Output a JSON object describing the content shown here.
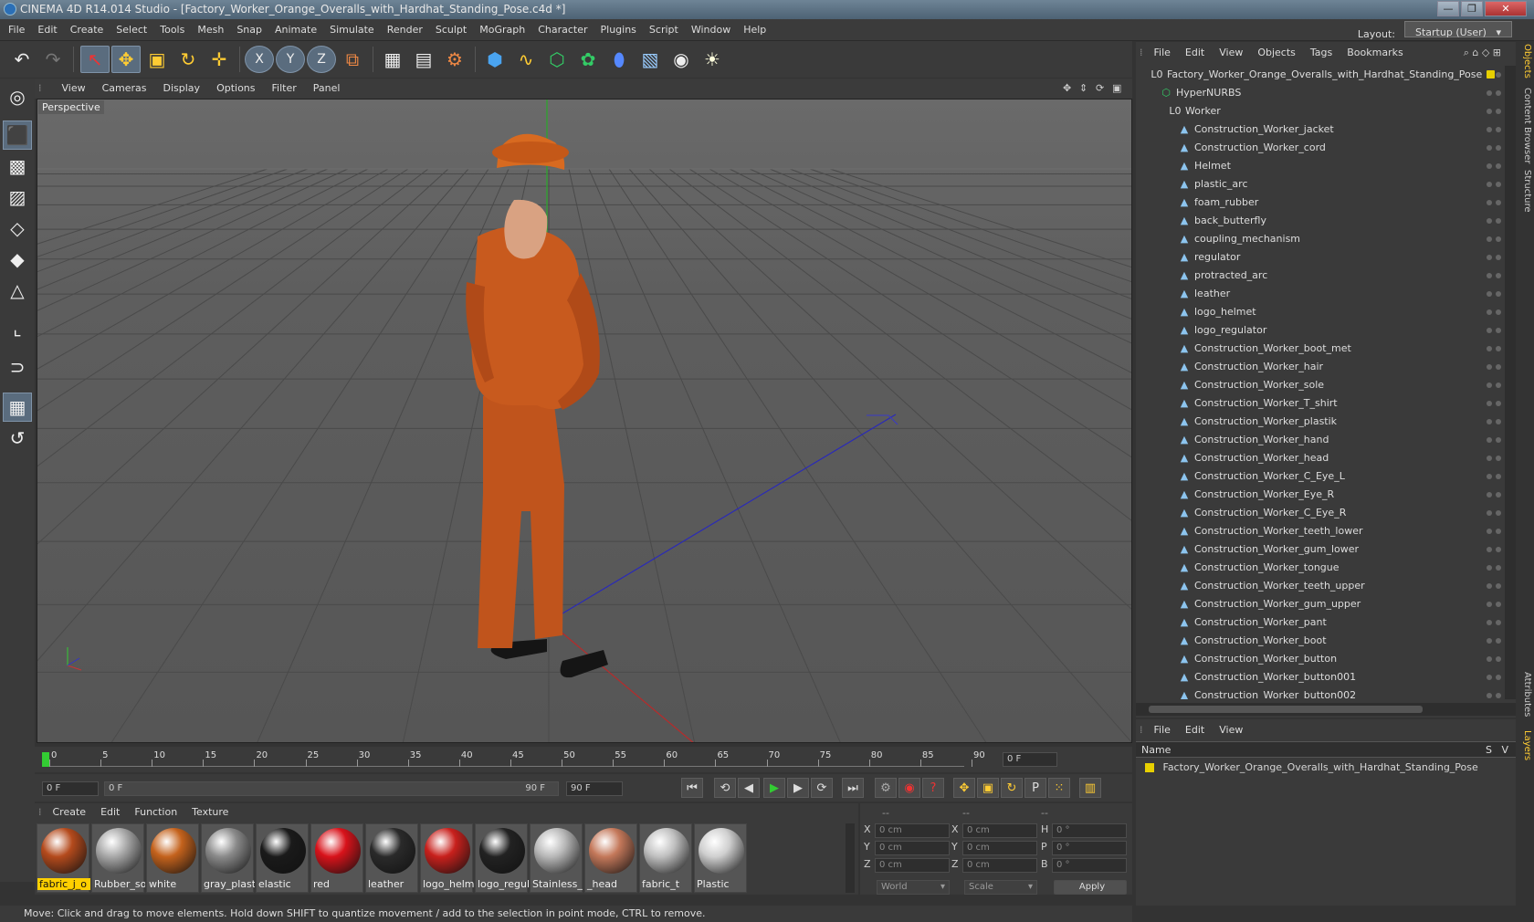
{
  "window": {
    "title": "CINEMA 4D R14.014 Studio - [Factory_Worker_Orange_Overalls_with_Hardhat_Standing_Pose.c4d *]",
    "controls": [
      "—",
      "❐",
      "✕"
    ]
  },
  "menubar": {
    "items": [
      "File",
      "Edit",
      "Create",
      "Select",
      "Tools",
      "Mesh",
      "Snap",
      "Animate",
      "Simulate",
      "Render",
      "Sculpt",
      "MoGraph",
      "Character",
      "Plugins",
      "Script",
      "Window",
      "Help"
    ],
    "layout_label": "Layout:",
    "layout_value": "Startup (User)"
  },
  "toolbar": {
    "icons": [
      "undo-icon",
      "redo-icon",
      "live-select-icon",
      "move-icon",
      "scale-icon",
      "rotate-icon",
      "add-icon",
      "x-axis-icon",
      "y-axis-icon",
      "z-axis-icon",
      "coordinate-system-icon",
      "render-view-icon",
      "render-picture-viewer-icon",
      "render-settings-icon",
      "cube-icon",
      "spline-icon",
      "nurbs-icon",
      "array-icon",
      "deformer-icon",
      "floor-icon",
      "camera-icon",
      "light-icon"
    ],
    "glyphs": {
      "undo": "↶",
      "redo": "↷",
      "live_select": "↖",
      "move": "✥",
      "scale": "▣",
      "rotate": "↻",
      "add": "✛",
      "x": "X",
      "y": "Y",
      "z": "Z",
      "coord": "⧉",
      "render_view": "▦",
      "render_pv": "▤",
      "render_set": "⚙",
      "cube": "⬢",
      "spline": "∿",
      "nurbs": "⬡",
      "array": "✿",
      "deformer": "⬮",
      "floor": "▧",
      "camera": "◉",
      "light": "☀"
    }
  },
  "left_toolbar": {
    "icons": [
      "make-editable-icon",
      "model-mode-icon",
      "texture-mode-icon",
      "workplane-mode-icon",
      "points-mode-icon",
      "edges-mode-icon",
      "polygons-mode-icon",
      "axis-mode-icon",
      "magnet-icon",
      "snap-grid-icon",
      "animate-icon"
    ],
    "glyphs": [
      "◎",
      "⬛",
      "▩",
      "▨",
      "◇",
      "◆",
      "△",
      "⌞",
      "⊃",
      "▦",
      "↺"
    ]
  },
  "viewport": {
    "menu": [
      "View",
      "Cameras",
      "Display",
      "Options",
      "Filter",
      "Panel"
    ],
    "label": "Perspective",
    "nav_icons": [
      "✥",
      "⇕",
      "⟳",
      "▣"
    ]
  },
  "timeline": {
    "ticks": [
      "0",
      "5",
      "10",
      "15",
      "20",
      "25",
      "30",
      "35",
      "40",
      "45",
      "50",
      "55",
      "60",
      "65",
      "70",
      "75",
      "80",
      "85",
      "90"
    ],
    "current_frame": "0 F"
  },
  "transport": {
    "start_field": "0 F",
    "range_start": "0 F",
    "range_end": "90 F",
    "end_field": "90 F",
    "buttons": [
      "⏮",
      "⟲",
      "◀",
      "▶",
      "▶",
      "⟳",
      "⏭"
    ],
    "key_buttons": [
      "⚙",
      "◉",
      "?",
      "✥",
      "▣",
      "↻",
      "P",
      "⁙",
      "▥"
    ]
  },
  "materials": {
    "menu": [
      "Create",
      "Edit",
      "Function",
      "Texture"
    ],
    "items": [
      {
        "label": "fabric_j_o",
        "color": "#b44a1c"
      },
      {
        "label": "Rubber_so",
        "color": "#a8a8a8"
      },
      {
        "label": "white",
        "color": "#c4621c"
      },
      {
        "label": "gray_plasti",
        "color": "#8a8a8a"
      },
      {
        "label": "elastic",
        "color": "#1a1a1a"
      },
      {
        "label": "red",
        "color": "#d8121a"
      },
      {
        "label": "leather",
        "color": "#2a2a2a"
      },
      {
        "label": "logo_helm",
        "color": "#c8201c"
      },
      {
        "label": "logo_regul",
        "color": "#222222"
      },
      {
        "label": "Stainless_",
        "color": "#b8b8b8"
      },
      {
        "label": "_head",
        "color": "#c4785a"
      },
      {
        "label": "fabric_t",
        "color": "#c0c0c0"
      },
      {
        "label": "Plastic",
        "color": "#cfcfcf"
      }
    ]
  },
  "coordinates": {
    "headers": [
      "--",
      "--",
      "--"
    ],
    "rows": [
      {
        "a": "X",
        "av": "0 cm",
        "b": "X",
        "bv": "0 cm",
        "c": "H",
        "cv": "0 °"
      },
      {
        "a": "Y",
        "av": "0 cm",
        "b": "Y",
        "bv": "0 cm",
        "c": "P",
        "cv": "0 °"
      },
      {
        "a": "Z",
        "av": "0 cm",
        "b": "Z",
        "bv": "0 cm",
        "c": "B",
        "cv": "0 °"
      }
    ],
    "mode1": "World",
    "mode2": "Scale",
    "apply": "Apply"
  },
  "status": "Move: Click and drag to move elements. Hold down SHIFT to quantize movement / add to the selection in point mode, CTRL to remove.",
  "objects": {
    "menu": [
      "File",
      "Edit",
      "View",
      "Objects",
      "Tags",
      "Bookmarks"
    ],
    "rows": [
      {
        "label": "Factory_Worker_Orange_Overalls_with_Hardhat_Standing_Pose",
        "indent": 0,
        "icon": "L0"
      },
      {
        "label": "HyperNURBS",
        "indent": 1,
        "icon": "⬡"
      },
      {
        "label": "Worker",
        "indent": 2,
        "icon": "L0"
      },
      {
        "label": "Construction_Worker_jacket",
        "indent": 3,
        "icon": "▲"
      },
      {
        "label": "Construction_Worker_cord",
        "indent": 3,
        "icon": "▲"
      },
      {
        "label": "Helmet",
        "indent": 3,
        "icon": "▲"
      },
      {
        "label": "plastic_arc",
        "indent": 3,
        "icon": "▲"
      },
      {
        "label": "foam_rubber",
        "indent": 3,
        "icon": "▲"
      },
      {
        "label": "back_butterfly",
        "indent": 3,
        "icon": "▲"
      },
      {
        "label": "coupling_mechanism",
        "indent": 3,
        "icon": "▲"
      },
      {
        "label": "regulator",
        "indent": 3,
        "icon": "▲"
      },
      {
        "label": "protracted_arc",
        "indent": 3,
        "icon": "▲"
      },
      {
        "label": "leather",
        "indent": 3,
        "icon": "▲"
      },
      {
        "label": "logo_helmet",
        "indent": 3,
        "icon": "▲"
      },
      {
        "label": "logo_regulator",
        "indent": 3,
        "icon": "▲"
      },
      {
        "label": "Construction_Worker_boot_met",
        "indent": 3,
        "icon": "▲"
      },
      {
        "label": "Construction_Worker_hair",
        "indent": 3,
        "icon": "▲"
      },
      {
        "label": "Construction_Worker_sole",
        "indent": 3,
        "icon": "▲"
      },
      {
        "label": "Construction_Worker_T_shirt",
        "indent": 3,
        "icon": "▲"
      },
      {
        "label": "Construction_Worker_plastik",
        "indent": 3,
        "icon": "▲"
      },
      {
        "label": "Construction_Worker_hand",
        "indent": 3,
        "icon": "▲"
      },
      {
        "label": "Construction_Worker_head",
        "indent": 3,
        "icon": "▲"
      },
      {
        "label": "Construction_Worker_C_Eye_L",
        "indent": 3,
        "icon": "▲"
      },
      {
        "label": "Construction_Worker_Eye_R",
        "indent": 3,
        "icon": "▲"
      },
      {
        "label": "Construction_Worker_C_Eye_R",
        "indent": 3,
        "icon": "▲"
      },
      {
        "label": "Construction_Worker_teeth_lower",
        "indent": 3,
        "icon": "▲"
      },
      {
        "label": "Construction_Worker_gum_lower",
        "indent": 3,
        "icon": "▲"
      },
      {
        "label": "Construction_Worker_tongue",
        "indent": 3,
        "icon": "▲"
      },
      {
        "label": "Construction_Worker_teeth_upper",
        "indent": 3,
        "icon": "▲"
      },
      {
        "label": "Construction_Worker_gum_upper",
        "indent": 3,
        "icon": "▲"
      },
      {
        "label": "Construction_Worker_pant",
        "indent": 3,
        "icon": "▲"
      },
      {
        "label": "Construction_Worker_boot",
        "indent": 3,
        "icon": "▲"
      },
      {
        "label": "Construction_Worker_button",
        "indent": 3,
        "icon": "▲"
      },
      {
        "label": "Construction_Worker_button001",
        "indent": 3,
        "icon": "▲"
      },
      {
        "label": "Construction_Worker_button002",
        "indent": 3,
        "icon": "▲"
      }
    ]
  },
  "side_tabs": [
    "Objects",
    "Content Browser",
    "Structure",
    "Attributes",
    "Layers"
  ],
  "layers": {
    "menu": [
      "File",
      "Edit",
      "View"
    ],
    "col_name": "Name",
    "col_s": "S",
    "col_v": "V",
    "row": "Factory_Worker_Orange_Overalls_with_Hardhat_Standing_Pose"
  },
  "colors": {
    "accent": "#5a6c7e",
    "orange": "#c0541c",
    "yellow": "#e8d000"
  }
}
